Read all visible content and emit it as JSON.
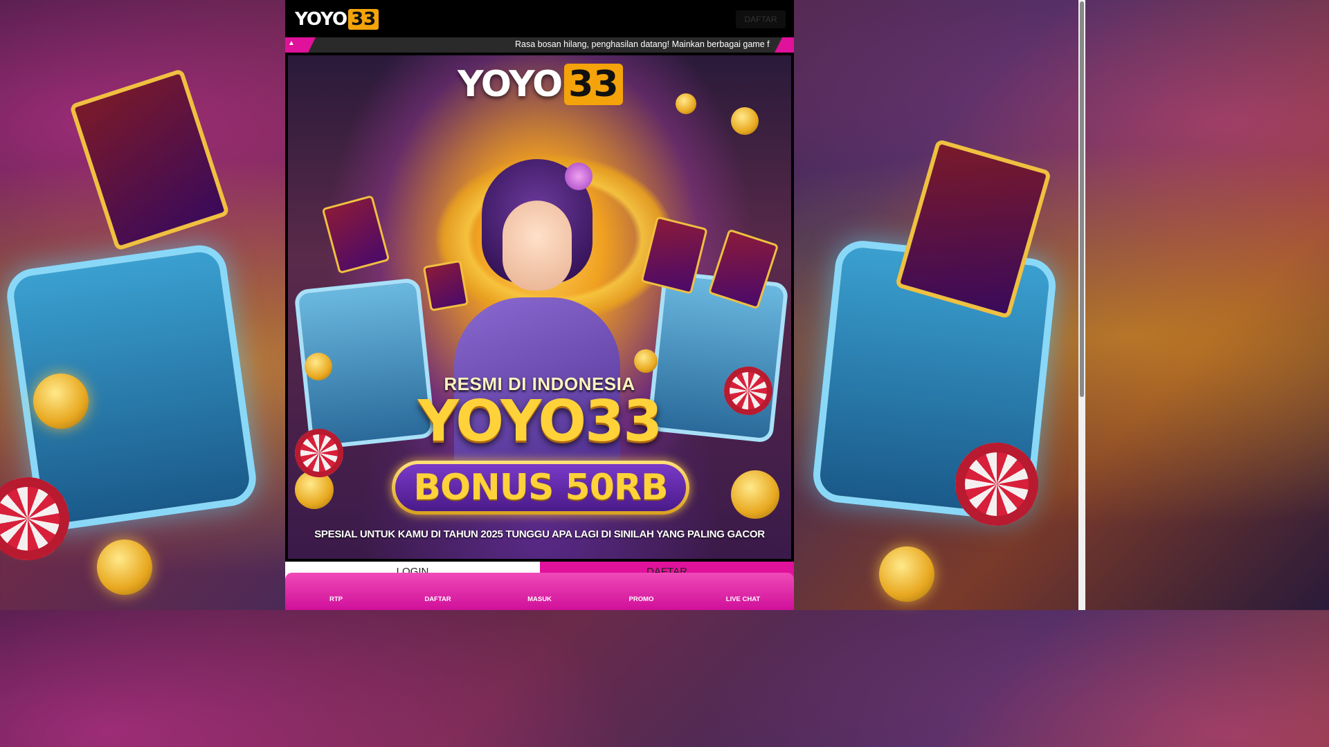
{
  "header": {
    "logo_text": "YOYO",
    "logo_number": "33",
    "daftar_label": "DAFTAR"
  },
  "ticker": {
    "icon": "speaker-icon",
    "text": "Rasa bosan hilang, penghasilan datang! Mainkan berbagai game favo"
  },
  "banner": {
    "logo_text": "YOYO",
    "logo_number": "33",
    "tagline": "RESMI DI INDONESIA",
    "title": "YOYO33",
    "bonus": "BONUS 50RB",
    "subtitle": "SPESIAL UNTUK KAMU DI TAHUN 2025 TUNGGU APA LAGI DI SINILAH YANG PALING GACOR"
  },
  "auth": {
    "login_icon": "",
    "login_label": "LOGIN",
    "daftar_icon": "",
    "daftar_label": "DAFTAR"
  },
  "bottom_nav": {
    "items": [
      {
        "label": "RTP",
        "icon": "rtp-icon",
        "glyph": ""
      },
      {
        "label": "DAFTAR",
        "icon": "register-icon",
        "glyph": ""
      },
      {
        "label": "MASUK",
        "icon": "login-icon",
        "glyph": ""
      },
      {
        "label": "PROMO",
        "icon": "gift-icon",
        "glyph": ""
      },
      {
        "label": "LIVE CHAT",
        "icon": "chat-icon",
        "glyph": ""
      }
    ]
  },
  "colors": {
    "accent": "#e0119a",
    "logo_badge": "#f4a30a",
    "ticker_bg": "#2a2a2a",
    "gold": "#ffd23a"
  }
}
